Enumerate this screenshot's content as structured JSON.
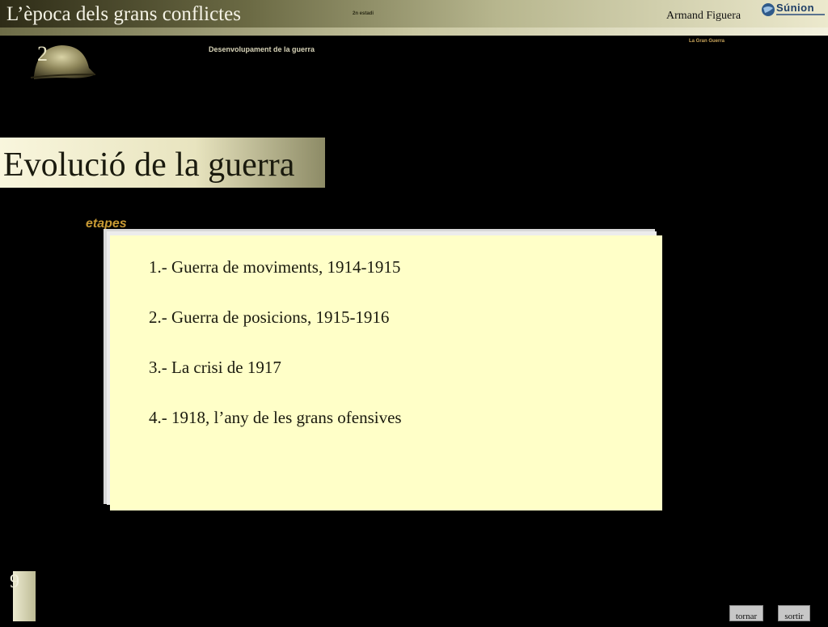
{
  "header": {
    "app_title": "L’època dels grans conflictes",
    "tiny_label": "2n estadi",
    "author": "Armand Figuera",
    "logo_text": "Súnion"
  },
  "chapter": {
    "number": "2",
    "subtitle": "Desenvolupament de la guerra",
    "course": "La Gran Guerra"
  },
  "main": {
    "title": "Evolució de la guerra",
    "section_label": "etapes",
    "stages": [
      "1.- Guerra de moviments, 1914-1915",
      "2.- Guerra de posicions, 1915-1916",
      "3.- La crisi de 1917",
      "4.- 1918, l’any de les grans ofensives"
    ]
  },
  "footer": {
    "slide_number": "9",
    "back_label": "tornar",
    "exit_label": "sortir"
  },
  "colors": {
    "card": "#ffffc8",
    "accent": "#c89a34",
    "background": "#000000"
  }
}
